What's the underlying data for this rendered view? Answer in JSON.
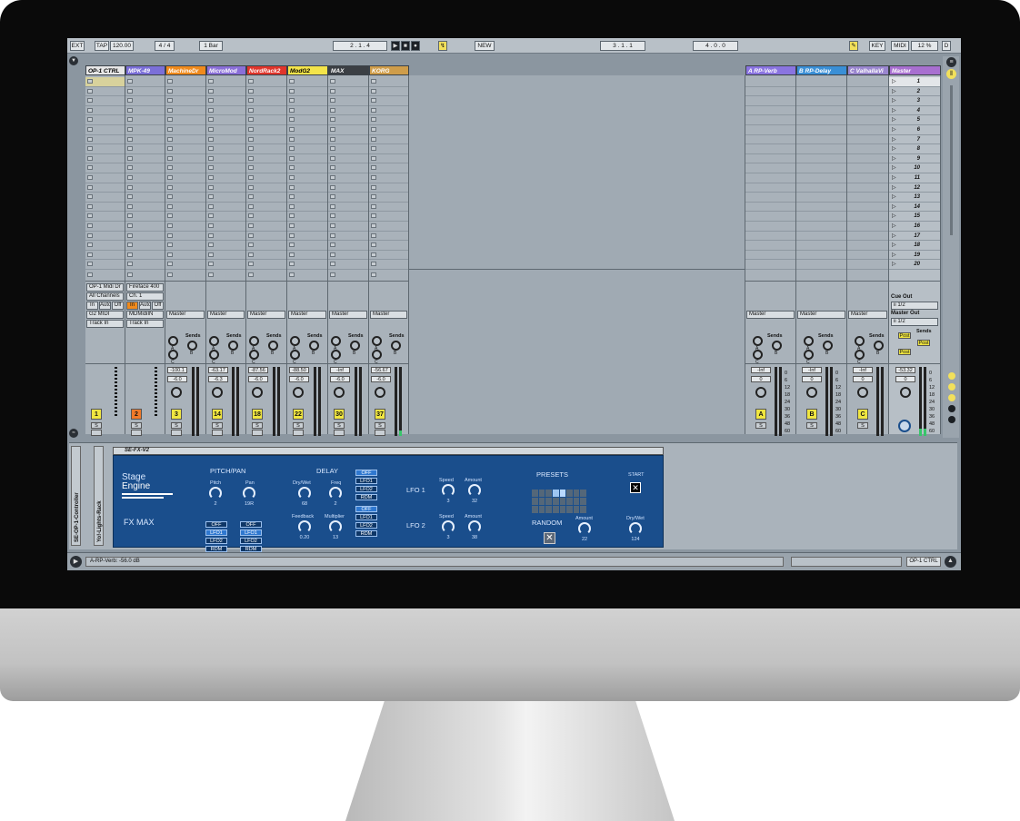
{
  "transport": {
    "ext": "EXT",
    "tap": "TAP",
    "tempo": "120.00",
    "sig": "4 / 4",
    "quant": "1 Bar",
    "pos": "2 .  1 .  4",
    "new": "NEW",
    "loop_start": "3 .  1 .  1",
    "loop_len": "4 .  0 .  0",
    "key": "KEY",
    "midi": "MIDI",
    "cpu": "12 %",
    "d": "D"
  },
  "tracks": [
    {
      "name": "OP-1 CTRL",
      "color": "#e7e7e7",
      "text_color": "#000",
      "input": "OP-1 Midi Dr",
      "channels": "All Channels",
      "monitor": [
        "In",
        "Auto",
        "Off"
      ],
      "out": "G2 MIDI",
      "out2": "Track In",
      "num": "1",
      "numcolor": "#f0e640"
    },
    {
      "name": "MPK-49",
      "color": "#7b6fd8",
      "text_color": "#fff",
      "input": "Fireface 400",
      "channels": "Ch. 1",
      "monitor": [
        "In",
        "Auto",
        "Off"
      ],
      "out": "MDMidiIN",
      "out2": "Track In",
      "num": "2",
      "numcolor": "#f07a2a"
    },
    {
      "name": "MachineDr",
      "color": "#f08a1c",
      "text_color": "#fff",
      "master": "Master",
      "vol": "-100.1",
      "vol2": "-6.0",
      "num": "3",
      "numcolor": "#f0e640"
    },
    {
      "name": "MicroMod",
      "color": "#8a6fd8",
      "text_color": "#fff",
      "master": "Master",
      "vol": "-63.17",
      "vol2": "-6.3",
      "num": "14",
      "numcolor": "#f0e640"
    },
    {
      "name": "NordRack2",
      "color": "#e0352b",
      "text_color": "#fff",
      "master": "Master",
      "vol": "-87.56",
      "vol2": "-6.0",
      "num": "18",
      "numcolor": "#f0e640"
    },
    {
      "name": "ModG2",
      "color": "#f4e44a",
      "text_color": "#000",
      "master": "Master",
      "vol": "-88.50",
      "vol2": "-6.0",
      "num": "22",
      "numcolor": "#f0e640"
    },
    {
      "name": "MAX",
      "color": "#3b3f44",
      "text_color": "#fff",
      "master": "Master",
      "vol": "-Inf",
      "vol2": "-6.0",
      "num": "30",
      "numcolor": "#f0e640"
    },
    {
      "name": "KORG",
      "color": "#cf9d4a",
      "text_color": "#fff",
      "master": "Master",
      "vol": "-56.67",
      "vol2": "-6.0",
      "num": "37",
      "numcolor": "#f0e640"
    }
  ],
  "returns": [
    {
      "name": "A RP-Verb",
      "color": "#8a74e0",
      "master": "Master",
      "vol": "-Inf",
      "vol2": "0",
      "num": "A"
    },
    {
      "name": "B RP-Delay",
      "color": "#3a8fd6",
      "master": "Master",
      "vol": "-Inf",
      "vol2": "0",
      "num": "B"
    },
    {
      "name": "C ValhallaVi",
      "color": "#9a86cf",
      "master": "Master",
      "vol": "-Inf",
      "vol2": "0",
      "num": "C"
    }
  ],
  "master": {
    "name": "Master",
    "color": "#a86fd0",
    "scenes": [
      "1",
      "2",
      "3",
      "4",
      "5",
      "6",
      "7",
      "8",
      "9",
      "10",
      "11",
      "12",
      "13",
      "14",
      "15",
      "16",
      "17",
      "18",
      "19",
      "20"
    ],
    "cue_out": "Cue Out",
    "cue_val": "ii 1/2",
    "master_out": "Master Out",
    "master_val": "ii 1/2",
    "vol": "-53.32",
    "vol2": "0",
    "post": "Post",
    "sends": "Sends"
  },
  "scale": [
    "0",
    "6",
    "12",
    "18",
    "24",
    "30",
    "36",
    "48",
    "60"
  ],
  "sends_label": "Sends",
  "solo": "S",
  "knob_letters": [
    "A",
    "B",
    "C"
  ],
  "device": {
    "title": "SE-FX-V2",
    "logo1": "Stage",
    "logo2": "Engine",
    "fxmax": "FX MAX",
    "pitchpan": "PITCH/PAN",
    "pitch": "Pitch",
    "pitch_val": "2",
    "pan": "Pan",
    "pan_val": "19R",
    "delay": "DELAY",
    "drywet": "Dry/Wet",
    "drywet_val": "68",
    "freq": "Freq",
    "freq_val": "2",
    "feedback": "Feedback",
    "feedback_val": "0.20",
    "multiplier": "Multiplier",
    "mult_val": "13",
    "lfo1": "LFO 1",
    "lfo2": "LFO 2",
    "speed": "Speed",
    "amount": "Amount",
    "lfo1_speed": "3",
    "lfo1_amount": "32",
    "lfo2_speed": "3",
    "lfo2_amount": "38",
    "presets": "PRESETS",
    "start": "START",
    "random": "RANDOM",
    "rand_amount": "22",
    "rand_drywet": "Dry/Wet",
    "rand_dw_val": "124",
    "modes": [
      "OFF",
      "LFO1",
      "LFO2",
      "RDM"
    ]
  },
  "racks": [
    "SE-OP-1-Controller",
    "Yo!-Lights-Rack"
  ],
  "status": {
    "left": "A-RP-Verb: -56.0 dB",
    "right": "OP-1 CTRL"
  }
}
